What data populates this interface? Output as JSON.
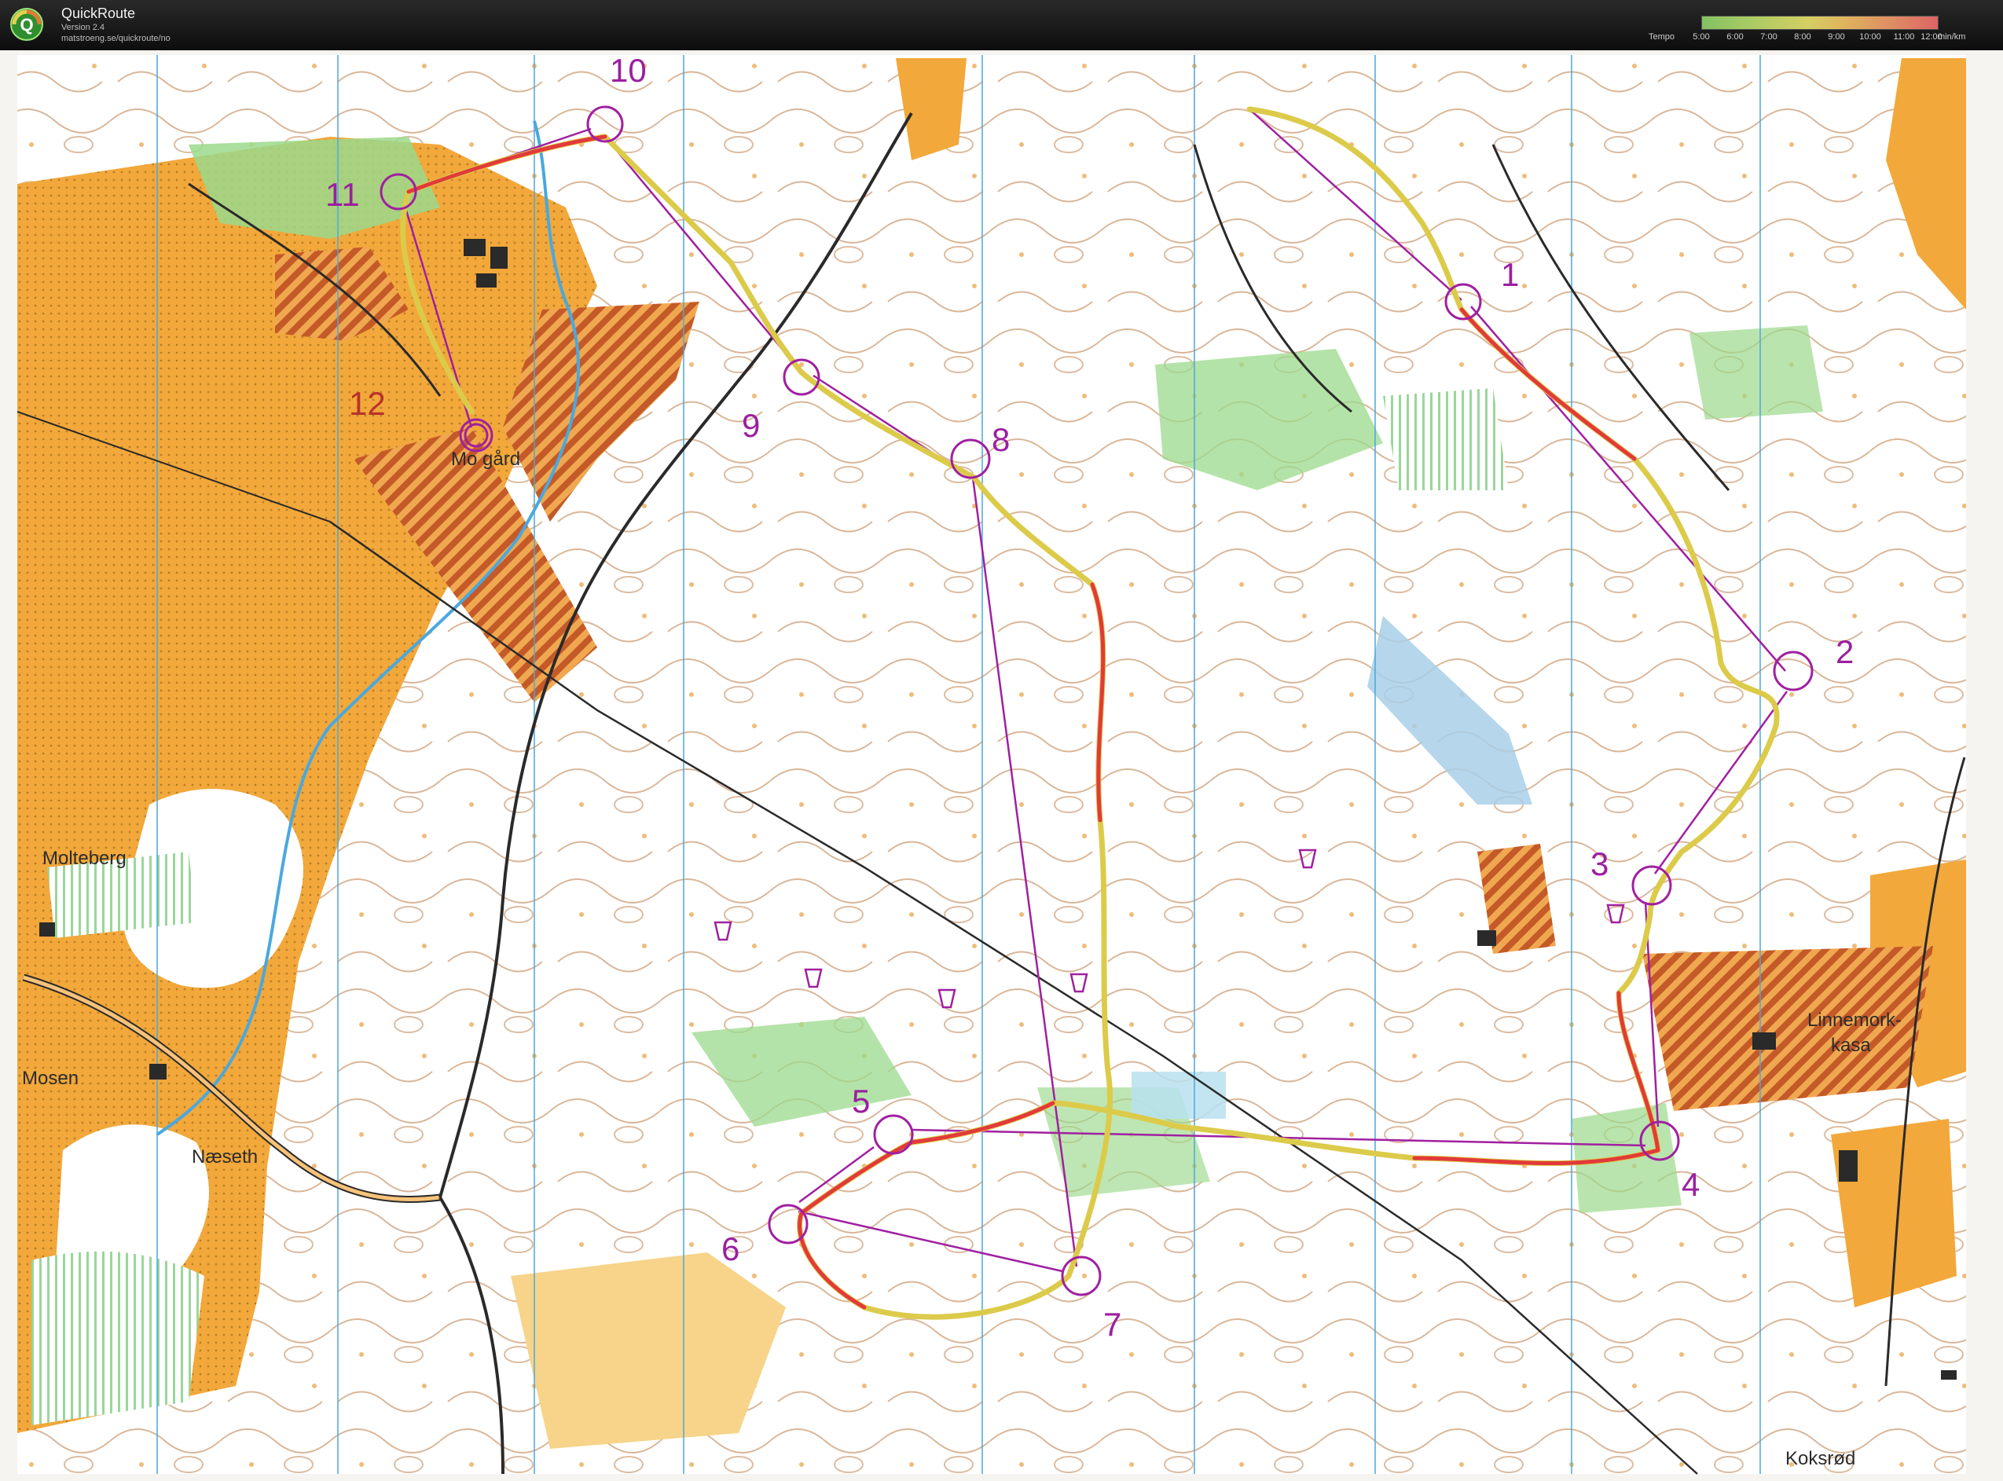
{
  "header": {
    "app_title": "QuickRoute",
    "version": "Version 2.4",
    "url": "matstroeng.se/quickroute/no",
    "logo_letter": "Q"
  },
  "tempo_legend": {
    "label": "Tempo",
    "ticks": [
      "5:00",
      "6:00",
      "7:00",
      "8:00",
      "9:00",
      "10:00",
      "11:00",
      "12:00"
    ],
    "unit": "min/km",
    "gradient_colors": [
      "#8fd46a",
      "#e8e26b",
      "#f49b6b",
      "#f06d6d"
    ]
  },
  "map": {
    "colors": {
      "open_land": "#f2a83a",
      "rough_open": "#f7d48a",
      "forest": "#ffffff",
      "green": "#8fd488",
      "contour": "#a8642e",
      "water": "#6fc3e3",
      "course": "#b01ea8",
      "route_slow": "#e63a3a",
      "route_fast": "#c8d85a",
      "north_lines": "#4aa8de",
      "road": "#2a2a2a",
      "cultivated": "#c9602a"
    },
    "place_names": [
      {
        "key": "molteberg",
        "text": "Molteberg"
      },
      {
        "key": "mosen",
        "text": "Mosen"
      },
      {
        "key": "naeseth",
        "text": "Næseth"
      },
      {
        "key": "mogard",
        "text": "Mo gård"
      },
      {
        "key": "linnemork",
        "text": "Linnemork-"
      },
      {
        "key": "kasa",
        "text": "kasa"
      },
      {
        "key": "koksrod",
        "text": "Koksrød"
      }
    ],
    "controls": [
      {
        "key": "c1",
        "label": "1"
      },
      {
        "key": "c2",
        "label": "2"
      },
      {
        "key": "c3",
        "label": "3"
      },
      {
        "key": "c4",
        "label": "4"
      },
      {
        "key": "c5",
        "label": "5"
      },
      {
        "key": "c6",
        "label": "6"
      },
      {
        "key": "c7",
        "label": "7"
      },
      {
        "key": "c8",
        "label": "8"
      },
      {
        "key": "c9",
        "label": "9"
      },
      {
        "key": "c10",
        "label": "10"
      },
      {
        "key": "c11",
        "label": "11"
      },
      {
        "key": "c12",
        "label": "12"
      }
    ]
  }
}
